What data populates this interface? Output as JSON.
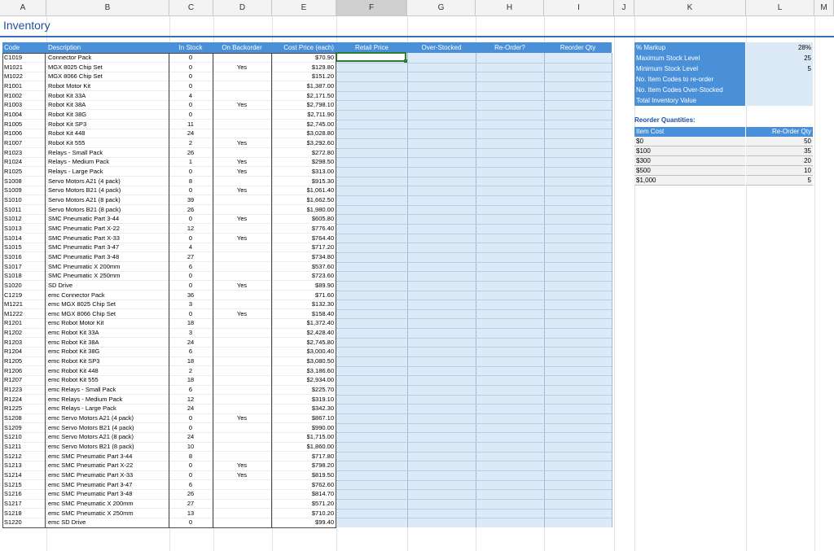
{
  "columns": [
    "A",
    "B",
    "C",
    "D",
    "E",
    "F",
    "G",
    "H",
    "I",
    "J",
    "K",
    "L",
    "M"
  ],
  "selected_column": "F",
  "sheet_title": "Inventory",
  "headers": {
    "code": "Code",
    "description": "Description",
    "in_stock": "In Stock",
    "on_backorder": "On Backorder",
    "cost_price": "Cost Price (each)",
    "retail_price": "Retail Price",
    "over_stocked": "Over-Stocked",
    "re_order": "Re-Order?",
    "reorder_qty": "Reorder Qty"
  },
  "rows": [
    {
      "code": "C1019",
      "desc": "Connector Pack",
      "stock": "0",
      "back": "",
      "cost": "$70.90"
    },
    {
      "code": "M1021",
      "desc": "MGX 8025 Chip Set",
      "stock": "0",
      "back": "Yes",
      "cost": "$129.80"
    },
    {
      "code": "M1022",
      "desc": "MGX 8066 Chip Set",
      "stock": "0",
      "back": "",
      "cost": "$151.20"
    },
    {
      "code": "R1001",
      "desc": "Robot Motor Kit",
      "stock": "0",
      "back": "",
      "cost": "$1,387.00"
    },
    {
      "code": "R1002",
      "desc": "Robot Kit 33A",
      "stock": "4",
      "back": "",
      "cost": "$2,171.50"
    },
    {
      "code": "R1003",
      "desc": "Robot Kit 38A",
      "stock": "0",
      "back": "Yes",
      "cost": "$2,798.10"
    },
    {
      "code": "R1004",
      "desc": "Robot Kit 38G",
      "stock": "0",
      "back": "",
      "cost": "$2,711.90"
    },
    {
      "code": "R1005",
      "desc": "Robot Kit SP3",
      "stock": "11",
      "back": "",
      "cost": "$2,745.00"
    },
    {
      "code": "R1006",
      "desc": "Robot Kit 448",
      "stock": "24",
      "back": "",
      "cost": "$3,028.80"
    },
    {
      "code": "R1007",
      "desc": "Robot Kit 555",
      "stock": "2",
      "back": "Yes",
      "cost": "$3,292.60"
    },
    {
      "code": "R1023",
      "desc": "Relays - Small Pack",
      "stock": "26",
      "back": "",
      "cost": "$272.80"
    },
    {
      "code": "R1024",
      "desc": "Relays - Medium Pack",
      "stock": "1",
      "back": "Yes",
      "cost": "$298.50"
    },
    {
      "code": "R1025",
      "desc": "Relays - Large Pack",
      "stock": "0",
      "back": "Yes",
      "cost": "$313.00"
    },
    {
      "code": "S1008",
      "desc": "Servo Motors A21 (4 pack)",
      "stock": "8",
      "back": "",
      "cost": "$915.30"
    },
    {
      "code": "S1009",
      "desc": "Servo Motors B21 (4 pack)",
      "stock": "0",
      "back": "Yes",
      "cost": "$1,061.40"
    },
    {
      "code": "S1010",
      "desc": "Servo Motors A21 (8 pack)",
      "stock": "39",
      "back": "",
      "cost": "$1,662.50"
    },
    {
      "code": "S1011",
      "desc": "Servo Motors B21 (8 pack)",
      "stock": "26",
      "back": "",
      "cost": "$1,980.00"
    },
    {
      "code": "S1012",
      "desc": "SMC Pneumatic Part 3-44",
      "stock": "0",
      "back": "Yes",
      "cost": "$605.80"
    },
    {
      "code": "S1013",
      "desc": "SMC Pneumatic Part X-22",
      "stock": "12",
      "back": "",
      "cost": "$776.40"
    },
    {
      "code": "S1014",
      "desc": "SMC Pneumatic Part X-33",
      "stock": "0",
      "back": "Yes",
      "cost": "$764.40"
    },
    {
      "code": "S1015",
      "desc": "SMC Pneumatic Part 3-47",
      "stock": "4",
      "back": "",
      "cost": "$717.20"
    },
    {
      "code": "S1016",
      "desc": "SMC Pneumatic Part 3-48",
      "stock": "27",
      "back": "",
      "cost": "$734.80"
    },
    {
      "code": "S1017",
      "desc": "SMC Pneumatic X 200mm",
      "stock": "6",
      "back": "",
      "cost": "$537.60"
    },
    {
      "code": "S1018",
      "desc": "SMC Pneumatic X 250mm",
      "stock": "0",
      "back": "",
      "cost": "$723.60"
    },
    {
      "code": "S1020",
      "desc": "SD Drive",
      "stock": "0",
      "back": "Yes",
      "cost": "$89.90"
    },
    {
      "code": "C1219",
      "desc": "emc Connector Pack",
      "stock": "36",
      "back": "",
      "cost": "$71.60"
    },
    {
      "code": "M1221",
      "desc": "emc MGX 8025 Chip Set",
      "stock": "3",
      "back": "",
      "cost": "$132.30"
    },
    {
      "code": "M1222",
      "desc": "emc MGX 8066 Chip Set",
      "stock": "0",
      "back": "Yes",
      "cost": "$158.40"
    },
    {
      "code": "R1201",
      "desc": "emc Robot Motor Kit",
      "stock": "18",
      "back": "",
      "cost": "$1,372.40"
    },
    {
      "code": "R1202",
      "desc": "emc Robot Kit 33A",
      "stock": "3",
      "back": "",
      "cost": "$2,428.40"
    },
    {
      "code": "R1203",
      "desc": "emc Robot Kit 38A",
      "stock": "24",
      "back": "",
      "cost": "$2,745.80"
    },
    {
      "code": "R1204",
      "desc": "emc Robot Kit 38G",
      "stock": "6",
      "back": "",
      "cost": "$3,000.40"
    },
    {
      "code": "R1205",
      "desc": "emc Robot Kit SP3",
      "stock": "18",
      "back": "",
      "cost": "$3,080.50"
    },
    {
      "code": "R1206",
      "desc": "emc Robot Kit 448",
      "stock": "2",
      "back": "",
      "cost": "$3,186.60"
    },
    {
      "code": "R1207",
      "desc": "emc Robot Kit 555",
      "stock": "18",
      "back": "",
      "cost": "$2,934.00"
    },
    {
      "code": "R1223",
      "desc": "emc Relays - Small Pack",
      "stock": "6",
      "back": "",
      "cost": "$225.70"
    },
    {
      "code": "R1224",
      "desc": "emc Relays - Medium Pack",
      "stock": "12",
      "back": "",
      "cost": "$319.10"
    },
    {
      "code": "R1225",
      "desc": "emc Relays - Large Pack",
      "stock": "24",
      "back": "",
      "cost": "$342.30"
    },
    {
      "code": "S1208",
      "desc": "emc Servo Motors A21 (4 pack)",
      "stock": "0",
      "back": "Yes",
      "cost": "$867.10"
    },
    {
      "code": "S1209",
      "desc": "emc Servo Motors B21 (4 pack)",
      "stock": "0",
      "back": "",
      "cost": "$990.00"
    },
    {
      "code": "S1210",
      "desc": "emc Servo Motors A21 (8 pack)",
      "stock": "24",
      "back": "",
      "cost": "$1,715.00"
    },
    {
      "code": "S1211",
      "desc": "emc Servo Motors B21 (8 pack)",
      "stock": "10",
      "back": "",
      "cost": "$1,860.00"
    },
    {
      "code": "S1212",
      "desc": "emc SMC Pneumatic Part 3-44",
      "stock": "8",
      "back": "",
      "cost": "$717.80"
    },
    {
      "code": "S1213",
      "desc": "emc SMC Pneumatic Part X-22",
      "stock": "0",
      "back": "Yes",
      "cost": "$798.20"
    },
    {
      "code": "S1214",
      "desc": "emc SMC Pneumatic Part X-33",
      "stock": "0",
      "back": "Yes",
      "cost": "$819.50"
    },
    {
      "code": "S1215",
      "desc": "emc SMC Pneumatic Part 3-47",
      "stock": "6",
      "back": "",
      "cost": "$762.60"
    },
    {
      "code": "S1216",
      "desc": "emc SMC Pneumatic Part 3-48",
      "stock": "26",
      "back": "",
      "cost": "$814.70"
    },
    {
      "code": "S1217",
      "desc": "emc SMC Pneumatic X 200mm",
      "stock": "27",
      "back": "",
      "cost": "$571.20"
    },
    {
      "code": "S1218",
      "desc": "emc SMC Pneumatic X 250mm",
      "stock": "13",
      "back": "",
      "cost": "$710.20"
    },
    {
      "code": "S1220",
      "desc": "emc SD Drive",
      "stock": "0",
      "back": "",
      "cost": "$99.40"
    }
  ],
  "settings": [
    {
      "label": "% Markup",
      "value": "28%"
    },
    {
      "label": "Maximum Stock Level",
      "value": "25"
    },
    {
      "label": "Minimum Stock Level",
      "value": "5"
    },
    {
      "label": "No. Item Codes to re-order",
      "value": ""
    },
    {
      "label": "No. Item Codes Over-Stocked",
      "value": ""
    },
    {
      "label": "Total Inventory Value",
      "value": ""
    }
  ],
  "reorder": {
    "title": "Reorder Quantities:",
    "cost_header": "Item Cost",
    "qty_header": "Re-Order Qty",
    "rows": [
      {
        "cost": "$0",
        "qty": "50"
      },
      {
        "cost": "$100",
        "qty": "35"
      },
      {
        "cost": "$300",
        "qty": "20"
      },
      {
        "cost": "$500",
        "qty": "10"
      },
      {
        "cost": "$1,000",
        "qty": "5"
      }
    ]
  }
}
